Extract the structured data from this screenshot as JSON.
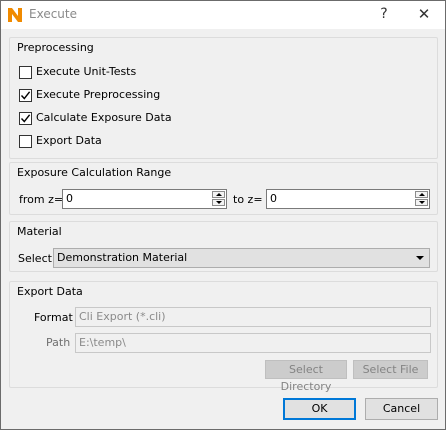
{
  "window": {
    "title": "Execute",
    "help_glyph": "?",
    "close_glyph": "✕"
  },
  "preprocessing": {
    "title": "Preprocessing",
    "options": [
      {
        "label": "Execute Unit-Tests",
        "checked": false
      },
      {
        "label": "Execute Preprocessing",
        "checked": true
      },
      {
        "label": "Calculate Exposure Data",
        "checked": true
      },
      {
        "label": "Export Data",
        "checked": false
      }
    ]
  },
  "range": {
    "title": "Exposure Calculation Range",
    "from_label": "from z=",
    "from_value": "0",
    "to_label": "to z=",
    "to_value": "0"
  },
  "material": {
    "title": "Material",
    "select_label": "Select",
    "selected": "Demonstration Material"
  },
  "export": {
    "title": "Export Data",
    "format_label": "Format",
    "format_value": "Cli Export (*.cli)",
    "path_label": "Path",
    "path_value": "E:\\temp\\",
    "select_directory": "Select Directory",
    "select_file": "Select File"
  },
  "footer": {
    "ok": "OK",
    "cancel": "Cancel"
  },
  "colors": {
    "icon_orange": "#f08a00",
    "focus_blue": "#0078d7"
  }
}
